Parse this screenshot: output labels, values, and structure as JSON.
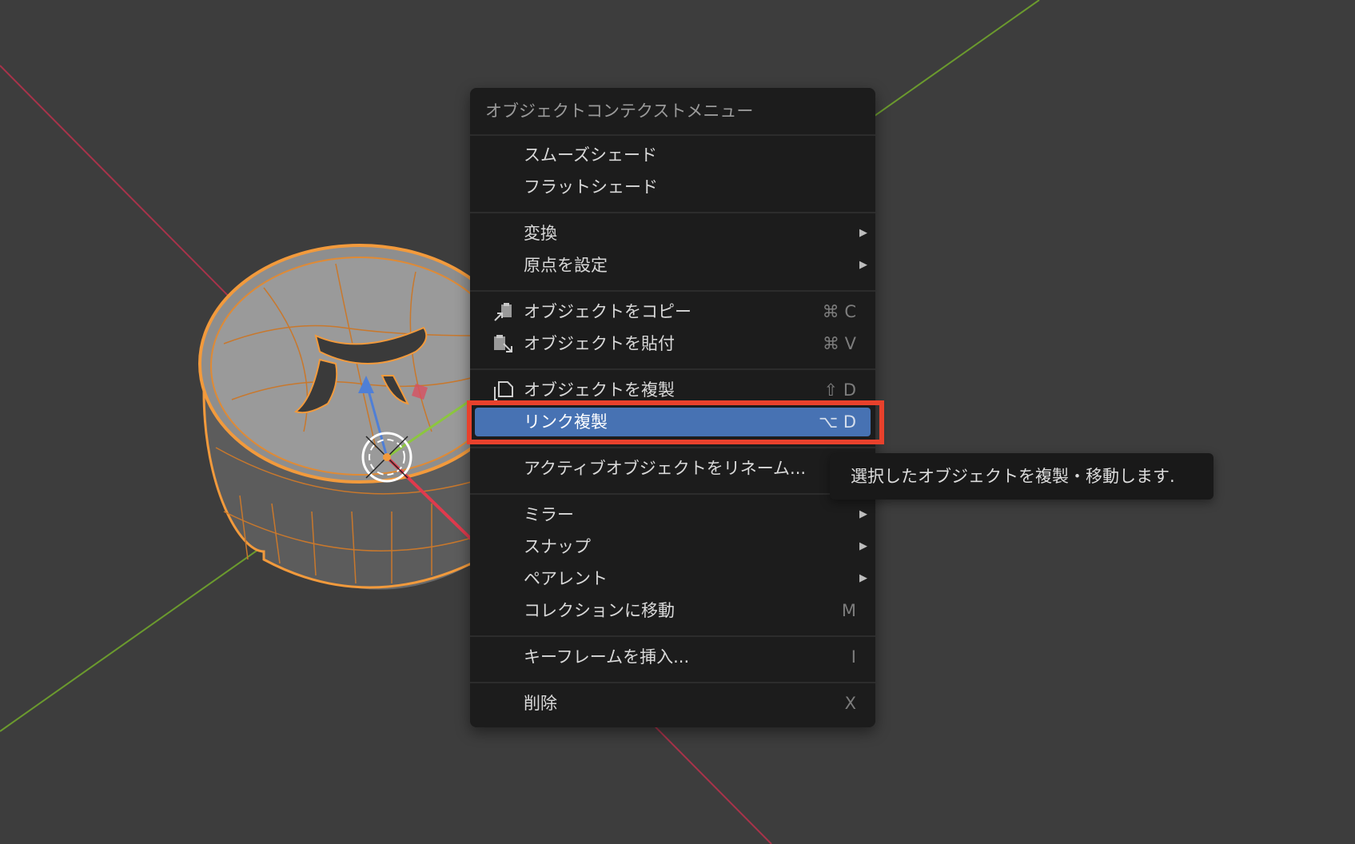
{
  "menu": {
    "title": "オブジェクトコンテクストメニュー",
    "items": [
      {
        "label": "スムーズシェード",
        "shortcut": "",
        "submenu": false
      },
      {
        "label": "フラットシェード",
        "shortcut": "",
        "submenu": false
      },
      {
        "label": "変換",
        "shortcut": "",
        "submenu": true
      },
      {
        "label": "原点を設定",
        "shortcut": "",
        "submenu": true
      },
      {
        "label": "オブジェクトをコピー",
        "shortcut": "⌘ C",
        "submenu": false,
        "icon": "copy-icon"
      },
      {
        "label": "オブジェクトを貼付",
        "shortcut": "⌘ V",
        "submenu": false,
        "icon": "paste-icon"
      },
      {
        "label": "オブジェクトを複製",
        "shortcut": "⇧ D",
        "submenu": false,
        "icon": "duplicate-icon"
      },
      {
        "label": "リンク複製",
        "shortcut": "⌥ D",
        "submenu": false,
        "active": true
      },
      {
        "label": "アクティブオブジェクトをリネーム...",
        "shortcut": "",
        "submenu": false
      },
      {
        "label": "ミラー",
        "shortcut": "",
        "submenu": true
      },
      {
        "label": "スナップ",
        "shortcut": "",
        "submenu": true
      },
      {
        "label": "ペアレント",
        "shortcut": "",
        "submenu": true
      },
      {
        "label": "コレクションに移動",
        "shortcut": "M",
        "submenu": false
      },
      {
        "label": "キーフレームを挿入...",
        "shortcut": "I",
        "submenu": false
      },
      {
        "label": "削除",
        "shortcut": "X",
        "submenu": false
      }
    ],
    "submenu_arrow": "▶"
  },
  "tooltip": {
    "text": "選択したオブジェクトを複製・移動します."
  },
  "colors": {
    "viewport_bg": "#3d3d3d",
    "menu_bg": "#1c1c1c",
    "active_item": "#4772b3",
    "highlight_box": "#e8412c",
    "x_axis": "#a8334a",
    "y_axis": "#6b9a2e",
    "selection_outline": "#f29a3c"
  }
}
